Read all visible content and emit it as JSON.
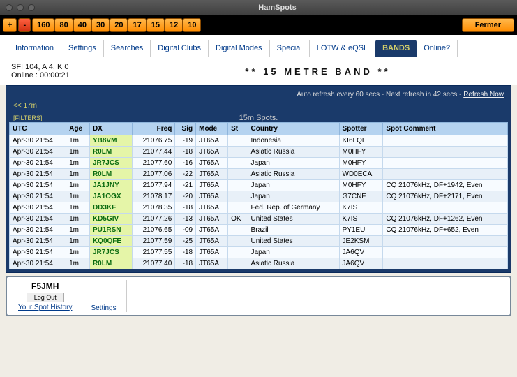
{
  "window": {
    "title": "HamSpots"
  },
  "bandbar": {
    "plus": "+",
    "minus": "-",
    "bands": [
      "160",
      "80",
      "40",
      "30",
      "20",
      "17",
      "15",
      "12",
      "10"
    ],
    "close": "Fermer"
  },
  "tabs": {
    "items": [
      "Information",
      "Settings",
      "Searches",
      "Digital Clubs",
      "Digital Modes",
      "Special",
      "LOTW & eQSL",
      "BANDS",
      "Online?"
    ],
    "active": 7
  },
  "status": {
    "sfi": "SFI 104, A 4, K 0",
    "online": "Online : 00:00:21",
    "heading": "**  15  METRE  BAND  **"
  },
  "panel": {
    "refresh_prefix": "Auto refresh every 60 secs - Next refresh in 42 secs - ",
    "refresh_link": "Refresh Now",
    "band_back": "<< 17m",
    "filters": "[FILTERS]",
    "spots_title": "15m Spots."
  },
  "table": {
    "headers": [
      "UTC",
      "Age",
      "DX",
      "Freq",
      "Sig",
      "Mode",
      "St",
      "Country",
      "Spotter",
      "Spot Comment"
    ],
    "rows": [
      {
        "utc": "Apr-30",
        "time": "21:54",
        "age": "1m",
        "dx": "YB8VM",
        "freq": "21076.75",
        "sig": "-19",
        "mode": "JT65A",
        "st": "",
        "country": "Indonesia",
        "spotter": "KI6LQL",
        "comment": ""
      },
      {
        "utc": "Apr-30",
        "time": "21:54",
        "age": "1m",
        "dx": "R0LM",
        "freq": "21077.44",
        "sig": "-18",
        "mode": "JT65A",
        "st": "",
        "country": "Asiatic Russia",
        "spotter": "M0HFY",
        "comment": ""
      },
      {
        "utc": "Apr-30",
        "time": "21:54",
        "age": "1m",
        "dx": "JR7JCS",
        "freq": "21077.60",
        "sig": "-16",
        "mode": "JT65A",
        "st": "",
        "country": "Japan",
        "spotter": "M0HFY",
        "comment": ""
      },
      {
        "utc": "Apr-30",
        "time": "21:54",
        "age": "1m",
        "dx": "R0LM",
        "freq": "21077.06",
        "sig": "-22",
        "mode": "JT65A",
        "st": "",
        "country": "Asiatic Russia",
        "spotter": "WD0ECA",
        "comment": ""
      },
      {
        "utc": "Apr-30",
        "time": "21:54",
        "age": "1m",
        "dx": "JA1JNY",
        "freq": "21077.94",
        "sig": "-21",
        "mode": "JT65A",
        "st": "",
        "country": "Japan",
        "spotter": "M0HFY",
        "comment": "CQ 21076kHz, DF+1942, Even"
      },
      {
        "utc": "Apr-30",
        "time": "21:54",
        "age": "1m",
        "dx": "JA1OGX",
        "freq": "21078.17",
        "sig": "-20",
        "mode": "JT65A",
        "st": "",
        "country": "Japan",
        "spotter": "G7CNF",
        "comment": "CQ 21076kHz, DF+2171, Even"
      },
      {
        "utc": "Apr-30",
        "time": "21:54",
        "age": "1m",
        "dx": "DD3KF",
        "freq": "21078.35",
        "sig": "-18",
        "mode": "JT65A",
        "st": "",
        "country": "Fed. Rep. of Germany",
        "spotter": "K7IS",
        "comment": ""
      },
      {
        "utc": "Apr-30",
        "time": "21:54",
        "age": "1m",
        "dx": "KD5GIV",
        "freq": "21077.26",
        "sig": "-13",
        "mode": "JT65A",
        "st": "OK",
        "country": "United States",
        "spotter": "K7IS",
        "comment": "CQ 21076kHz, DF+1262, Even"
      },
      {
        "utc": "Apr-30",
        "time": "21:54",
        "age": "1m",
        "dx": "PU1RSN",
        "freq": "21076.65",
        "sig": "-09",
        "mode": "JT65A",
        "st": "",
        "country": "Brazil",
        "spotter": "PY1EU",
        "comment": "CQ 21076kHz, DF+652, Even"
      },
      {
        "utc": "Apr-30",
        "time": "21:54",
        "age": "1m",
        "dx": "KQ0QFE",
        "freq": "21077.59",
        "sig": "-25",
        "mode": "JT65A",
        "st": "",
        "country": "United States",
        "spotter": "JE2KSM",
        "comment": ""
      },
      {
        "utc": "Apr-30",
        "time": "21:54",
        "age": "1m",
        "dx": "JR7JCS",
        "freq": "21077.55",
        "sig": "-18",
        "mode": "JT65A",
        "st": "",
        "country": "Japan",
        "spotter": "JA6QV",
        "comment": ""
      },
      {
        "utc": "Apr-30",
        "time": "21:54",
        "age": "1m",
        "dx": "R0LM",
        "freq": "21077.40",
        "sig": "-18",
        "mode": "JT65A",
        "st": "",
        "country": "Asiatic Russia",
        "spotter": "JA6QV",
        "comment": ""
      }
    ]
  },
  "footer": {
    "callsign": "F5JMH",
    "logout": "Log Out",
    "history": "Your Spot History",
    "settings": "Settings"
  }
}
